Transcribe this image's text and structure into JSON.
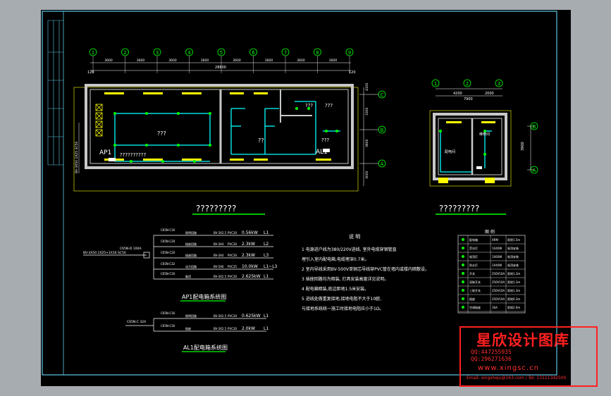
{
  "colors": {
    "background": "#a7acb1",
    "sheet": "#000000",
    "frame": "#5ec8e8",
    "wall": "#c8c8c8",
    "yellow": "#ffff00",
    "white": "#ffffff",
    "cyan": "#00ffff",
    "green": "#00ff00",
    "red": "#ff2020"
  },
  "plan_left": {
    "title": "?????????",
    "axes": [
      "1",
      "2",
      "3",
      "4",
      "5",
      "6",
      "7",
      "8",
      "9"
    ],
    "rows": [
      "C",
      "B",
      "A"
    ],
    "dims_top": [
      "3600",
      "3600",
      "3600",
      "3600",
      "3600",
      "3600",
      "3600",
      "3600"
    ],
    "dim_total": "28800",
    "dim_left": "120",
    "dim_right": "120",
    "dims_side": [
      "4100",
      "3300",
      "3600",
      "3000"
    ],
    "room_label_main": "???",
    "room_label_small1": "???",
    "room_label_small2": "???",
    "room_label_small3": "???",
    "room_label_mid": "??",
    "panel_ap1": "AP1",
    "panel_al1": "AL1",
    "note_ap1": "??????????",
    "cable_in": "BV-3X50 1X25 SC50"
  },
  "plan_right": {
    "title": "?????????",
    "axes": [
      "1",
      "2",
      "3"
    ],
    "rows": [
      "B",
      "A"
    ],
    "dims_top": [
      "4200",
      "2000"
    ],
    "dim_total": "7900",
    "dim_side": "3900",
    "room_label_a": "配电间",
    "room_label_b": "维修间"
  },
  "diagram_ap1": {
    "title": "AP1配电箱系统图",
    "incoming_cable": "BV-3X50 1X25+1X16 SC50",
    "main_breaker": "C65N-D 100A",
    "rows": [
      {
        "breaker": "C65N-C16",
        "desc": "照明回路",
        "cable": "BV-3X2.5",
        "pipe": "PVC20",
        "power": "0.56kW",
        "phase": "L1"
      },
      {
        "breaker": "C65N-C20",
        "desc": "插座回路",
        "cable": "BV-3X4",
        "pipe": "PVC20",
        "power": "2.3kW",
        "phase": "L2"
      },
      {
        "breaker": "C65N-C20",
        "desc": "插座回路",
        "cable": "BV-3X4",
        "pipe": "PVC20",
        "power": "2.3kW",
        "phase": "L3"
      },
      {
        "breaker": "C65N-C32",
        "desc": "动力回路",
        "cable": "BV-5X6",
        "pipe": "PVC25",
        "power": "10.0kW",
        "phase": "L1~L3"
      },
      {
        "breaker": "C65N-C16",
        "desc": "备用",
        "cable": "BV-3X2.5",
        "pipe": "PVC20",
        "power": "2.625kW",
        "phase": "L1"
      }
    ]
  },
  "diagram_al1": {
    "title": "AL1配电箱系统图",
    "main_breaker": "C65N-C 32A",
    "rows": [
      {
        "breaker": "C65N-C16",
        "desc": "照明回路",
        "cable": "BV-3X2.5",
        "pipe": "PVC20",
        "power": "0.625kW",
        "phase": "L1"
      },
      {
        "breaker": "C65N-C16",
        "desc": "插座",
        "cable": "BV-3X2.5",
        "pipe": "PVC20",
        "power": "2.0kW",
        "phase": "L1"
      }
    ]
  },
  "notes": {
    "heading": "说 明",
    "lines": [
      "1 电源进户线为380/220V进线, 室外电缆穿钢管直",
      "   埋引入室内配电箱,电缆埋深0.7米。",
      "2 室内导线采用BV-500V单铜芯导线穿PVC管在墙内或楼内暗敷设。",
      "3 插座回路均为暗装, 灯具安装高度详见说明。",
      "4 配电箱暗装,底边距地1.5米安装。",
      "5 进线处做重复接地,接地电阻不大于10欧,",
      "   与接地系统统一施工时接地电阻应小于1Ω。"
    ]
  },
  "legend": {
    "heading": "图 例",
    "rows": [
      {
        "name": "配电箱",
        "spec": "XRM",
        "note": "距地1.5m"
      },
      {
        "name": "荧光灯",
        "spec": "1X40W",
        "note": "吸顶安装"
      },
      {
        "name": "吸顶灯",
        "spec": "1X60W",
        "note": "吸顶安装"
      },
      {
        "name": "防水灯",
        "spec": "1X40W",
        "note": "吸顶安装"
      },
      {
        "name": "开关",
        "spec": "250V10A",
        "note": "距地1.3m"
      },
      {
        "name": "双联开关",
        "spec": "250V10A",
        "note": "距地1.3m"
      },
      {
        "name": "三联开关",
        "spec": "250V10A",
        "note": "距地1.3m"
      },
      {
        "name": "插座",
        "spec": "250V10A",
        "note": "距地0.3m"
      },
      {
        "name": "空调插座",
        "spec": "16A",
        "note": "距地2.0m"
      }
    ]
  },
  "watermark": {
    "title": "星欣设计图库",
    "qq1": "QQ:447255935",
    "qq2": "QQ:296271636",
    "site": "www.xingsc.cn",
    "mail": "Email: xingsheju@163.com / Tel: 13111342500"
  }
}
